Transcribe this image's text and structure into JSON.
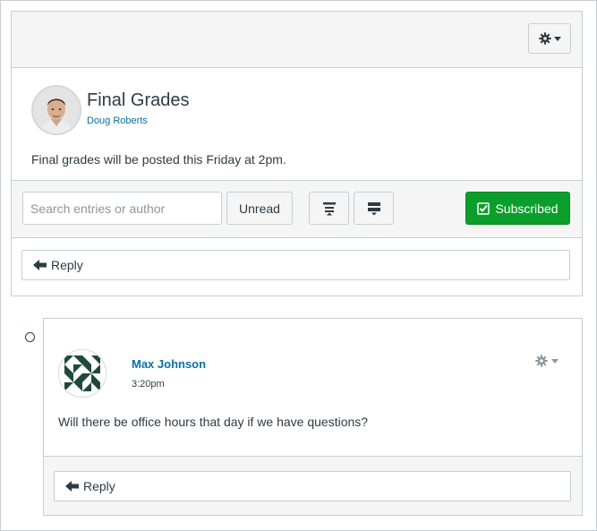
{
  "topic": {
    "title": "Final Grades",
    "author": "Doug Roberts",
    "message": "Final grades will be posted this Friday at 2pm."
  },
  "toolbar": {
    "search_placeholder": "Search entries or author",
    "unread_label": "Unread",
    "subscribed_label": "Subscribed"
  },
  "reply": {
    "label": "Reply"
  },
  "entry": {
    "author": "Max Johnson",
    "time": "3:20pm",
    "message": "Will there be office hours that day if we have questions?",
    "reply_label": "Reply"
  },
  "colors": {
    "link": "#0770a3",
    "subscribed_bg": "#0b9e2b",
    "panel_bg": "#f5f5f5",
    "border": "#c7cdd1"
  },
  "icons": {
    "settings": "gear-icon",
    "collapse": "collapse-replies-icon",
    "expand": "expand-replies-icon",
    "subscribed": "checkmark-icon",
    "reply": "arrow-left-icon"
  }
}
